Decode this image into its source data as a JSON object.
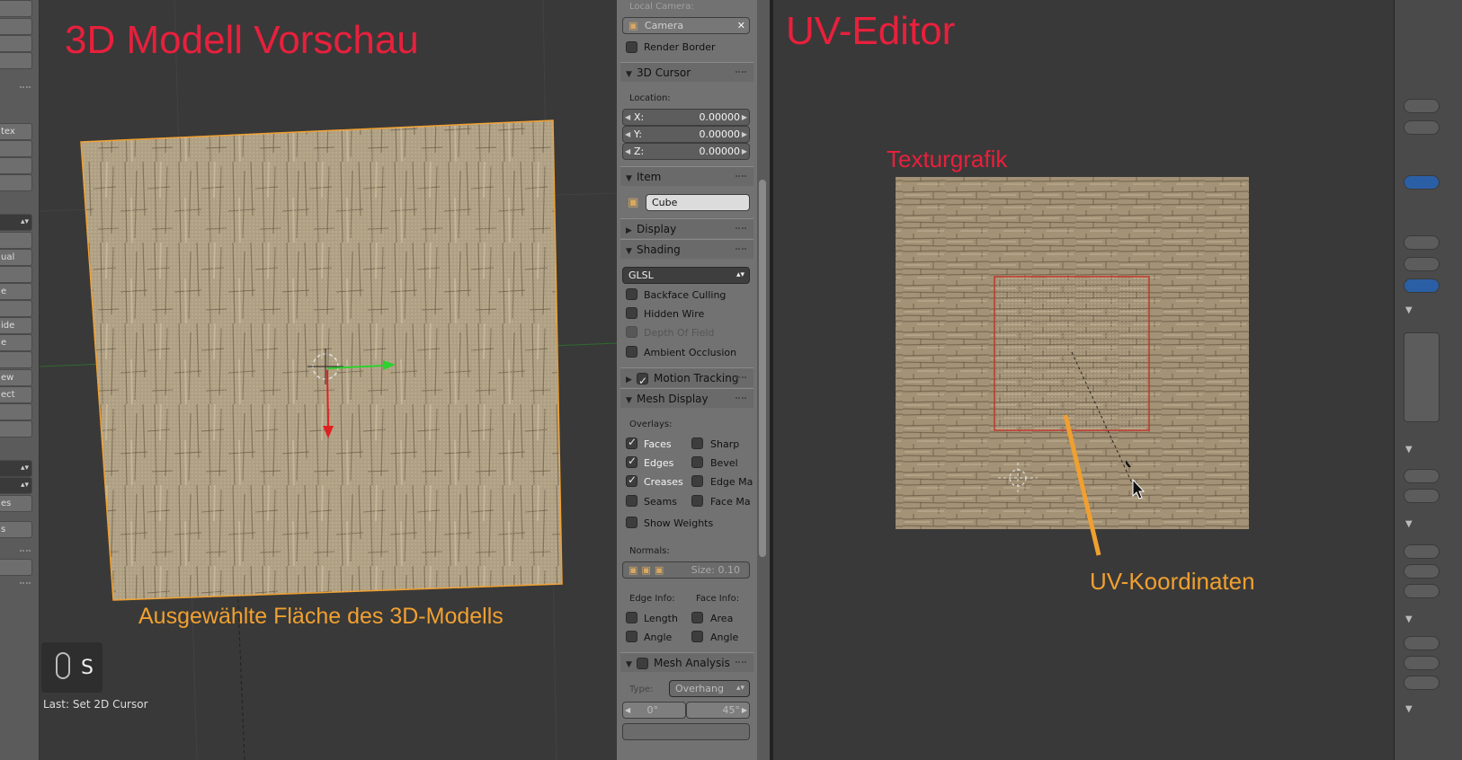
{
  "tool_shelf": {
    "items": [
      "",
      "",
      "",
      "tex",
      "",
      "",
      "",
      "",
      "ual",
      "",
      "e",
      "",
      "ide",
      "e",
      "",
      "ew",
      "ect",
      "",
      "",
      "",
      "es",
      "s"
    ]
  },
  "viewport": {
    "title": "3D Modell Vorschau",
    "caption": "Ausgewählte Fläche des 3D-Modells",
    "key_display": "S",
    "last_operator": "Last: Set 2D Cursor"
  },
  "properties": {
    "local_camera_label": "Local Camera:",
    "camera_field": "Camera",
    "render_border": "Render Border",
    "cursor_panel": "3D Cursor",
    "location_label": "Location:",
    "x_label": "X:",
    "x_value": "0.00000",
    "y_label": "Y:",
    "y_value": "0.00000",
    "z_label": "Z:",
    "z_value": "0.00000",
    "item_panel": "Item",
    "item_name": "Cube",
    "display_panel": "Display",
    "shading_panel": "Shading",
    "shading_mode": "GLSL",
    "backface_culling": "Backface Culling",
    "hidden_wire": "Hidden Wire",
    "depth_of_field": "Depth Of Field",
    "ambient_occlusion": "Ambient Occlusion",
    "motion_tracking": "Motion Tracking",
    "mesh_display_panel": "Mesh Display",
    "overlays_label": "Overlays:",
    "faces": "Faces",
    "sharp": "Sharp",
    "edges": "Edges",
    "bevel": "Bevel",
    "creases": "Creases",
    "edge_marks": "Edge Ma",
    "seams": "Seams",
    "face_marks": "Face Ma",
    "show_weights": "Show Weights",
    "normals_label": "Normals:",
    "normals_size": "Size:  0.10",
    "edge_info_label": "Edge Info:",
    "face_info_label": "Face Info:",
    "length": "Length",
    "area": "Area",
    "angle_edge": "Angle",
    "angle_face": "Angle",
    "mesh_analysis_panel": "Mesh Analysis",
    "type_label": "Type:",
    "type_value": "Overhang",
    "min_angle": "0°",
    "max_angle": "45°"
  },
  "uv_editor": {
    "title": "UV-Editor",
    "texture_label": "Texturgrafik",
    "uv_coords_label": "UV-Koordinaten"
  },
  "colors": {
    "annotation_red": "#e8203c",
    "annotation_orange": "#f0a030",
    "panel_bg": "#727272",
    "viewport_bg": "#393939"
  }
}
